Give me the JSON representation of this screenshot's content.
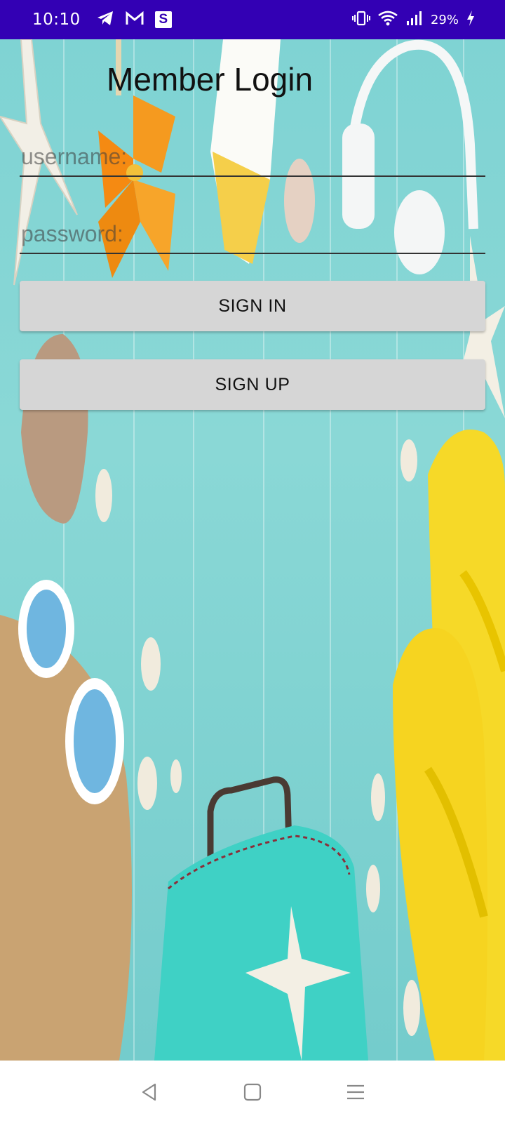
{
  "status_bar": {
    "time": "10:10",
    "battery_percent": "29%",
    "left_icons": [
      "telegram-icon",
      "gmail-icon",
      "s-app-icon"
    ],
    "right_icons": [
      "vibrate-icon",
      "wifi-icon",
      "signal-icon",
      "charging-icon"
    ],
    "s_app_letter": "S"
  },
  "login": {
    "title": "Member Login",
    "username_placeholder": "username:",
    "password_placeholder": "password:",
    "signin_label": "SIGN IN",
    "signup_label": "SIGN UP"
  },
  "nav_bar": {
    "buttons": [
      "back",
      "home",
      "menu"
    ]
  },
  "colors": {
    "status_bar": "#3300b4",
    "button_bg": "#d6d6d6",
    "background_teal": "#7fd3d3"
  }
}
